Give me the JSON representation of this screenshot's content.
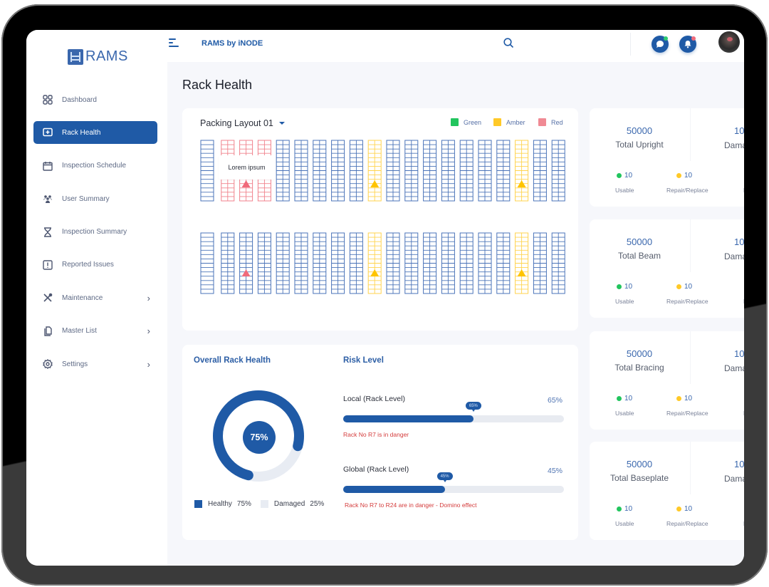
{
  "app": {
    "logo_text": "RAMS",
    "title": "RAMS by iNODE"
  },
  "sidebar": {
    "items": [
      {
        "label": "Dashboard",
        "icon": "grid-icon",
        "active": false,
        "has_chevron": false
      },
      {
        "label": "Rack Health",
        "icon": "rack-health-icon",
        "active": true,
        "has_chevron": false
      },
      {
        "label": "Inspection Schedule",
        "icon": "calendar-icon",
        "active": false,
        "has_chevron": false
      },
      {
        "label": "User Summary",
        "icon": "users-icon",
        "active": false,
        "has_chevron": false
      },
      {
        "label": "Inspection Summary",
        "icon": "hourglass-icon",
        "active": false,
        "has_chevron": false
      },
      {
        "label": "Reported Issues",
        "icon": "alert-square-icon",
        "active": false,
        "has_chevron": false
      },
      {
        "label": "Maintenance",
        "icon": "tools-icon",
        "active": false,
        "has_chevron": true
      },
      {
        "label": "Master List",
        "icon": "copy-icon",
        "active": false,
        "has_chevron": true
      },
      {
        "label": "Settings",
        "icon": "gear-icon",
        "active": false,
        "has_chevron": true
      }
    ]
  },
  "topbar": {
    "search_icon": "search-icon",
    "chat_icon": "chat-icon",
    "bell_icon": "bell-icon",
    "chat_badge_color": "#2ecc71",
    "bell_badge_color": "#f06a7a"
  },
  "page": {
    "title": "Rack Health"
  },
  "layout": {
    "selected": "Packing Layout 01",
    "legend": [
      {
        "label": "Green",
        "color": "#22c55e"
      },
      {
        "label": "Amber",
        "color": "#ffc928"
      },
      {
        "label": "Red",
        "color": "#f08a94"
      }
    ],
    "tooltip": "Lorem ipsum",
    "rows": [
      {
        "racks": [
          "blue-single",
          "red",
          "red",
          "red",
          "blue",
          "blue",
          "blue",
          "blue",
          "blue",
          "amber",
          "blue",
          "blue",
          "blue",
          "blue",
          "blue",
          "blue",
          "blue",
          "amber",
          "blue",
          "blue"
        ],
        "warnings": [
          {
            "rack": 3,
            "level": "red"
          },
          {
            "rack": 10,
            "level": "amber"
          },
          {
            "rack": 18,
            "level": "amber"
          }
        ]
      },
      {
        "racks": [
          "blue-single",
          "blue",
          "blue",
          "blue",
          "blue",
          "blue",
          "blue",
          "blue",
          "blue",
          "amber",
          "blue",
          "blue",
          "blue",
          "blue",
          "blue",
          "blue",
          "blue",
          "amber",
          "blue",
          "blue"
        ],
        "warnings": [
          {
            "rack": 3,
            "level": "red"
          },
          {
            "rack": 10,
            "level": "amber"
          },
          {
            "rack": 18,
            "level": "amber"
          }
        ]
      }
    ]
  },
  "overall": {
    "title": "Overall Rack Health",
    "center_label": "75%",
    "healthy_fraction": 0.75,
    "legend": [
      {
        "label": "Healthy",
        "value": "75%",
        "color": "#1f5aa6"
      },
      {
        "label": "Damaged",
        "value": "25%",
        "color": "#e8ecf3"
      }
    ]
  },
  "risk": {
    "title": "Risk Level",
    "items": [
      {
        "label": "Local (Rack Level)",
        "value_text": "65%",
        "bubble": "65%",
        "fraction": 0.59,
        "message": "Rack No R7 is in danger"
      },
      {
        "label": "Global (Rack Level)",
        "value_text": "45%",
        "bubble": "45%",
        "fraction": 0.46,
        "message": "Rack No R7 to R24 are in danger - Domino effect"
      }
    ]
  },
  "stats": [
    {
      "total": "50000",
      "label": "Total Upright",
      "damaged_value": "10",
      "damaged_label": "Dama",
      "usable": "10",
      "usable_label": "Usable",
      "repair": "10",
      "repair_label": "Repair/Replace",
      "third_label": "R"
    },
    {
      "total": "50000",
      "label": "Total Beam",
      "damaged_value": "10",
      "damaged_label": "Dama",
      "usable": "10",
      "usable_label": "Usable",
      "repair": "10",
      "repair_label": "Repair/Replace",
      "third_label": "R"
    },
    {
      "total": "50000",
      "label": "Total Bracing",
      "damaged_value": "10",
      "damaged_label": "Dama",
      "usable": "10",
      "usable_label": "Usable",
      "repair": "10",
      "repair_label": "Repair/Replace",
      "third_label": "R"
    },
    {
      "total": "50000",
      "label": "Total Baseplate",
      "damaged_value": "10",
      "damaged_label": "Dama",
      "usable": "10",
      "usable_label": "Usable",
      "repair": "10",
      "repair_label": "Repair/Replace",
      "third_label": "R"
    }
  ],
  "colors": {
    "primary": "#1f5aa6",
    "rack_blue": "#4a73b8",
    "rack_red": "#f0828c",
    "rack_amber": "#ffd34d",
    "danger_text": "#d43b3b",
    "usable_dot": "#22c55e",
    "repair_dot": "#ffc928"
  }
}
